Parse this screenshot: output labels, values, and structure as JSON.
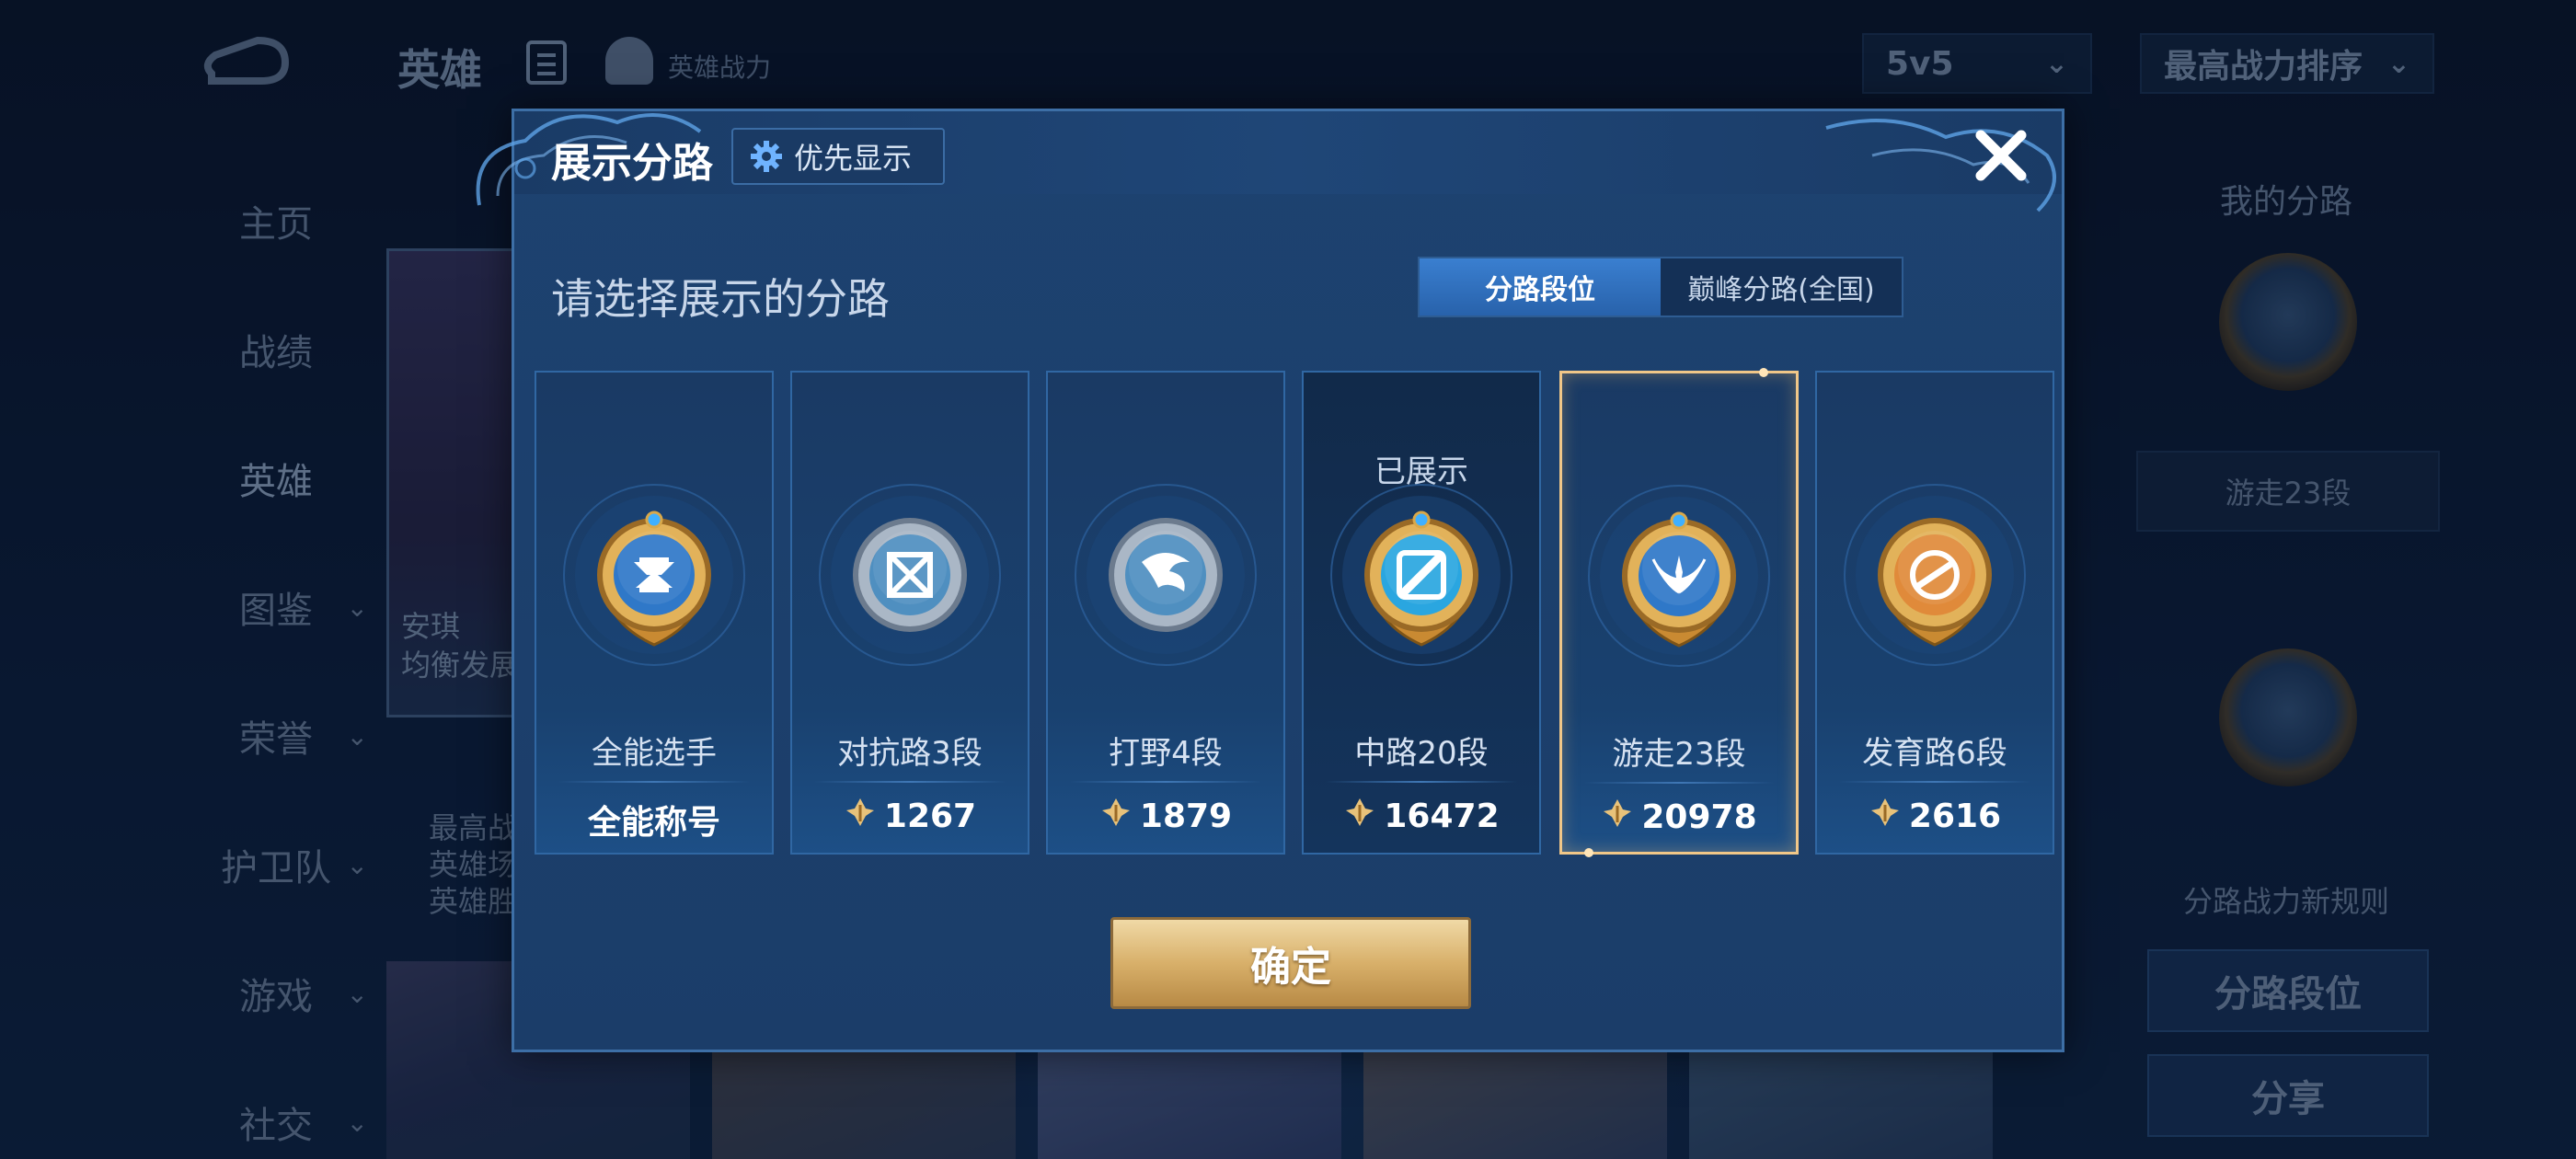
{
  "background": {
    "top_bar": {
      "title": "英雄",
      "power_label": "英雄战力",
      "mode_dropdown": "5v5",
      "sort_dropdown": "最高战力排序"
    },
    "side_nav": [
      {
        "label": "主页",
        "has_chevron": false
      },
      {
        "label": "战绩",
        "has_chevron": false
      },
      {
        "label": "英雄",
        "has_chevron": false,
        "active": true
      },
      {
        "label": "图鉴",
        "has_chevron": true
      },
      {
        "label": "荣誉",
        "has_chevron": true
      },
      {
        "label": "护卫队",
        "has_chevron": true
      },
      {
        "label": "游戏",
        "has_chevron": true
      },
      {
        "label": "社交",
        "has_chevron": true
      }
    ],
    "hero_card_text": [
      "安琪",
      "均衡发展"
    ],
    "hero_info_lines": [
      "最高战",
      "英雄场",
      "英雄胜"
    ],
    "right_panel": {
      "title": "我的分路",
      "tag": "游走23段",
      "rule_text": "分路战力新规则",
      "button_lane": "分路段位",
      "button_share": "分享"
    }
  },
  "modal": {
    "title": "展示分路",
    "priority_button": "优先显示",
    "subtitle": "请选择展示的分路",
    "segment": {
      "options": [
        "分路段位",
        "巅峰分路(全国)"
      ],
      "active_index": 0
    },
    "cards": [
      {
        "name": "全能选手",
        "value": "全能称号",
        "show_icon": false,
        "shown": false,
        "selected": false,
        "badge": "all-round",
        "accent": "#2f78c8"
      },
      {
        "name": "对抗路3段",
        "value": "1267",
        "show_icon": true,
        "shown": false,
        "selected": false,
        "badge": "clash",
        "accent": "#4f8fc0"
      },
      {
        "name": "打野4段",
        "value": "1879",
        "show_icon": true,
        "shown": false,
        "selected": false,
        "badge": "jungle",
        "accent": "#4f8fc0"
      },
      {
        "name": "中路20段",
        "value": "16472",
        "show_icon": true,
        "shown": true,
        "selected": false,
        "shown_label": "已展示",
        "badge": "mid",
        "accent": "#2aa6e0"
      },
      {
        "name": "游走23段",
        "value": "20978",
        "show_icon": true,
        "shown": false,
        "selected": true,
        "badge": "roam",
        "accent": "#2f78c8"
      },
      {
        "name": "发育路6段",
        "value": "2616",
        "show_icon": true,
        "shown": false,
        "selected": false,
        "badge": "farm",
        "accent": "#e08a3a"
      }
    ],
    "confirm_button": "确定"
  }
}
